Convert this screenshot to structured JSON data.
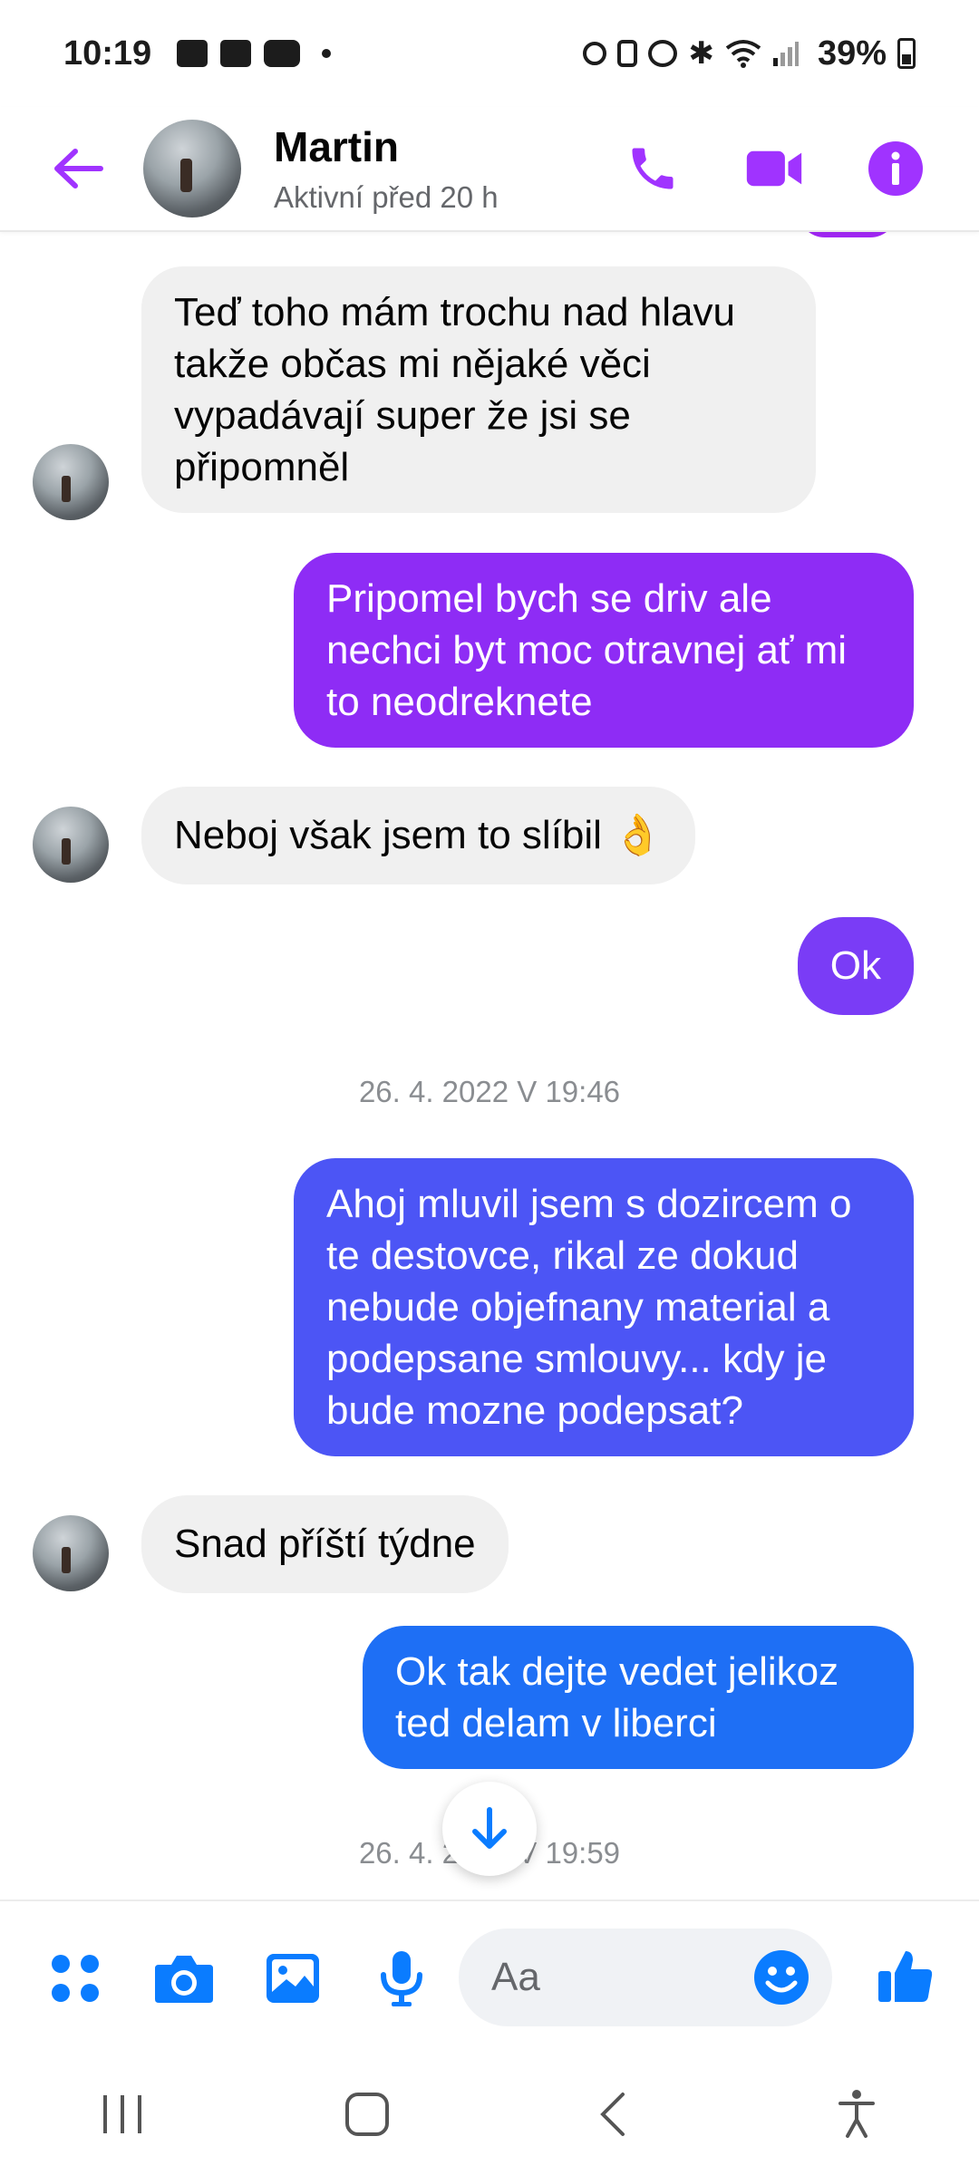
{
  "status_bar": {
    "time": "10:19",
    "battery": "39%"
  },
  "header": {
    "name": "Martin",
    "subtitle": "Aktivní před 20 h"
  },
  "messages": [
    {
      "side": "in",
      "text": "Teď toho mám trochu nad hlavu takže občas mi nějaké věci vypadávají super že jsi se připomněl"
    },
    {
      "side": "out",
      "text": "Pripomel bych se driv ale nechci byt moc otravnej ať mi to neodreknete"
    },
    {
      "side": "in",
      "text": "Neboj však jsem to slíbil 👌"
    },
    {
      "side": "out",
      "text": "Ok"
    },
    {
      "side": "out",
      "text": "Ahoj mluvil jsem s dozircem o te destovce, rikal ze dokud nebude objefnany material a podepsane smlouvy... kdy je bude mozne podepsat?"
    },
    {
      "side": "in",
      "text": "Snad příští týdne"
    },
    {
      "side": "out",
      "text": "Ok tak dejte vedet jelikoz ted delam v liberci"
    }
  ],
  "timestamps": [
    "26. 4. 2022 V 19:46",
    "26. 4. 2022 V 19:59"
  ],
  "composer": {
    "placeholder": "Aa"
  },
  "colors": {
    "accent": "#a033ff",
    "bubble_purple": "#8e2cf5",
    "bubble_indigo": "#4c55f5",
    "bubble_blue": "#1e6ff5",
    "composer_icon": "#0a7cff",
    "incoming_bubble": "#f0f0f0"
  }
}
